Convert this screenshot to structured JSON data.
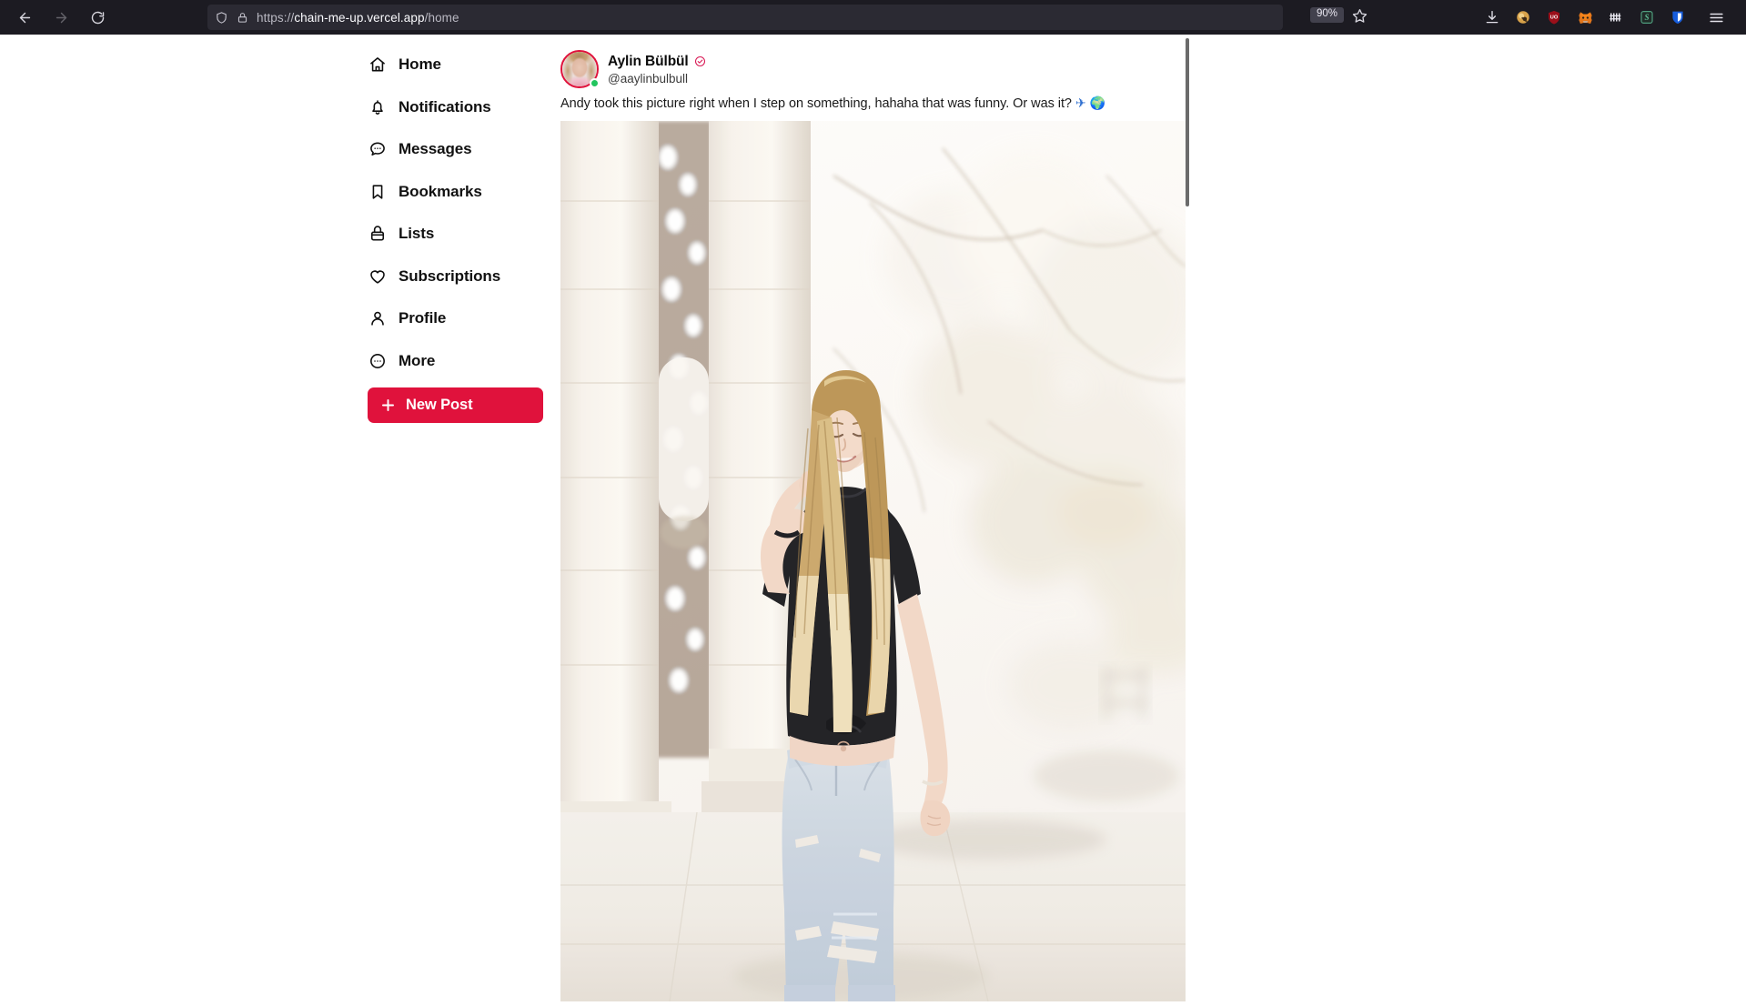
{
  "browser": {
    "back_label": "Back",
    "forward_label": "Forward",
    "reload_label": "Reload",
    "url_display": "https://chain-me-up.vercel.app/home",
    "url_scheme": "https://",
    "url_host": "chain-me-up.vercel.app",
    "url_path": "/home",
    "zoom_level": "90%",
    "bookmark_label": "Bookmark this page",
    "shield_label": "Tracking protection",
    "lock_label": "Connection secure",
    "extensions": [
      {
        "name": "downloads-icon",
        "label": "Downloads"
      },
      {
        "name": "wallet-extension-icon",
        "label": "Wallet"
      },
      {
        "name": "ublock-origin-icon",
        "label": "uBlock Origin"
      },
      {
        "name": "metamask-icon",
        "label": "MetaMask"
      },
      {
        "name": "keyboard-extension-icon",
        "label": "Extension"
      },
      {
        "name": "s-extension-icon",
        "label": "S Extension"
      },
      {
        "name": "bitwarden-icon",
        "label": "Bitwarden"
      }
    ],
    "menu_label": "Open application menu"
  },
  "sidebar": {
    "items": [
      {
        "label": "Home",
        "icon": "home-icon"
      },
      {
        "label": "Notifications",
        "icon": "bell-icon"
      },
      {
        "label": "Messages",
        "icon": "message-icon"
      },
      {
        "label": "Bookmarks",
        "icon": "bookmark-icon"
      },
      {
        "label": "Lists",
        "icon": "lists-icon"
      },
      {
        "label": "Subscriptions",
        "icon": "heart-icon"
      },
      {
        "label": "Profile",
        "icon": "person-icon"
      },
      {
        "label": "More",
        "icon": "more-circle-icon"
      }
    ],
    "new_post_label": "New Post",
    "new_post_color": "#e0123c"
  },
  "post": {
    "display_name": "Aylin Bülbül",
    "handle": "@aaylinbulbull",
    "verified": true,
    "verified_color": "#d91a55",
    "online": true,
    "online_color": "#22c55e",
    "text": "Andy took this picture right when I step on something, hahaha that was funny. Or was it?",
    "emoji_1": "✈",
    "emoji_2": "🌍",
    "image_alt": "Blonde woman in black t-shirt and light ripped jeans walking between white marble columns"
  }
}
